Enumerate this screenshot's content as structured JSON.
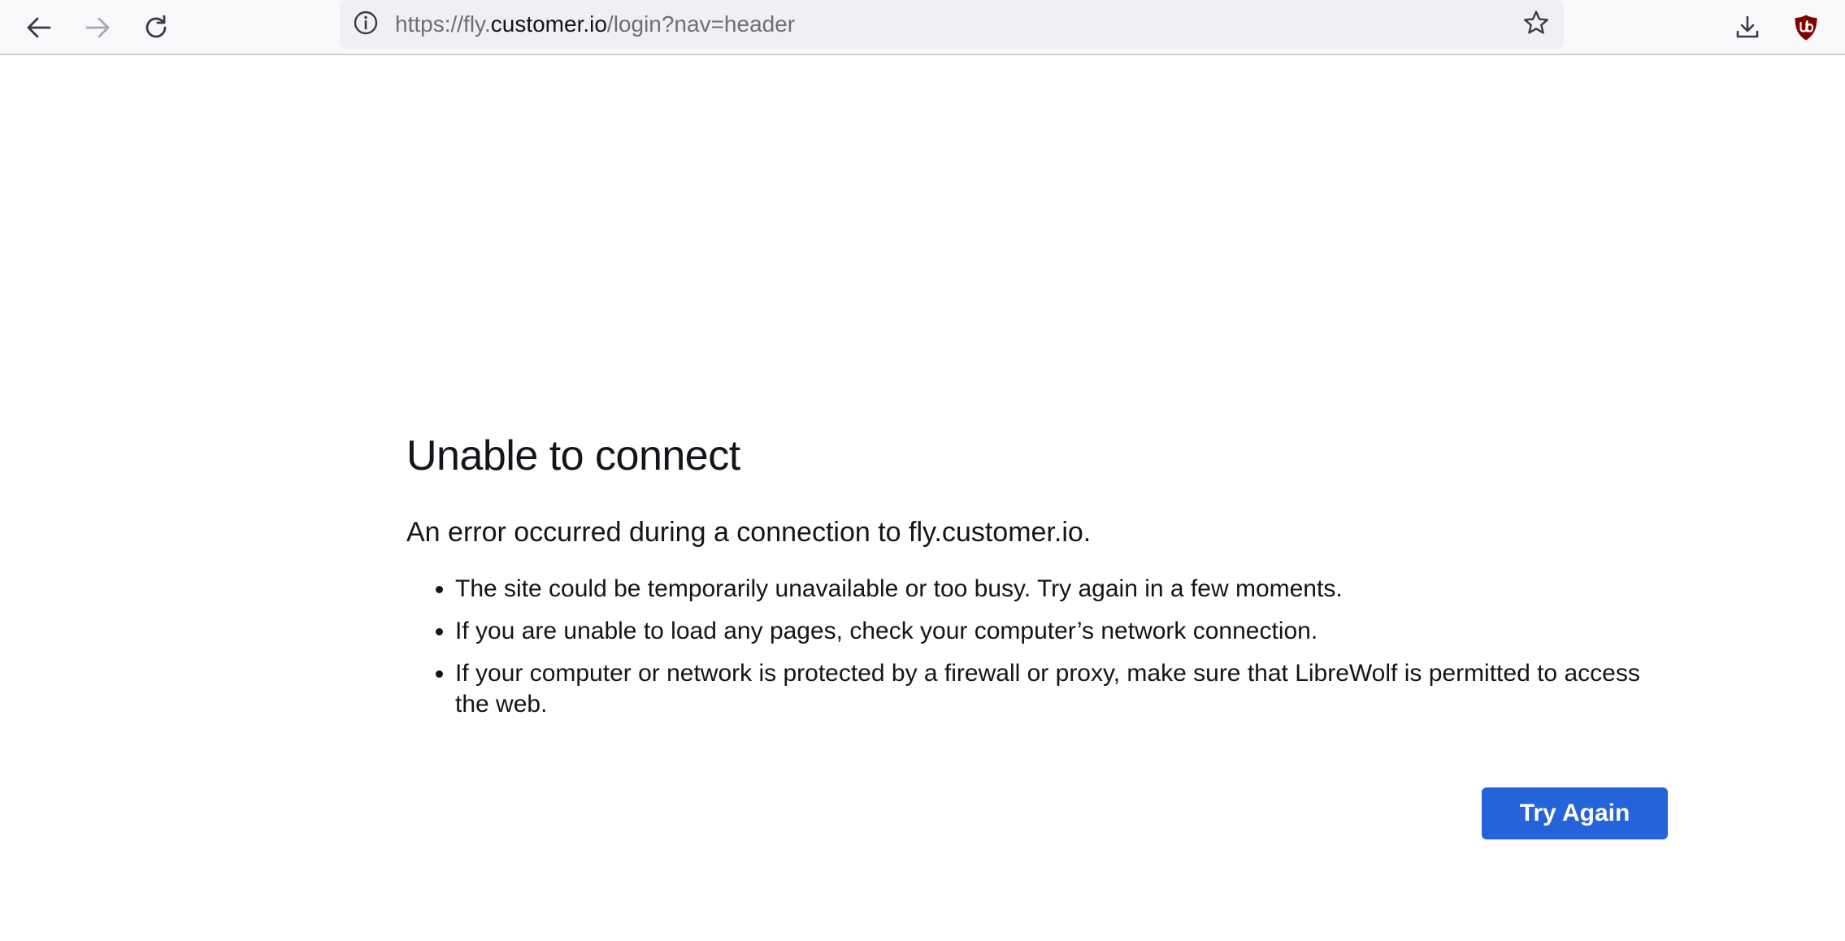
{
  "browser": {
    "url": {
      "prefix": "https://fly.",
      "host": "customer.io",
      "suffix": "/login?nav=header"
    },
    "icons": {
      "back": "arrow-left-icon",
      "forward": "arrow-right-icon",
      "reload": "reload-icon",
      "site_info": "info-circle-icon",
      "bookmark": "star-icon",
      "downloads": "download-icon",
      "extension": "ublock-origin-icon"
    },
    "colors": {
      "toolbar_bg": "#f9f9fb",
      "urlbar_bg": "#f0f0f4",
      "ublock_red": "#800000"
    }
  },
  "error_page": {
    "title": "Unable to connect",
    "description": "An error occurred during a connection to fly.customer.io.",
    "suggestions": [
      "The site could be temporarily unavailable or too busy. Try again in a few moments.",
      "If you are unable to load any pages, check your computer’s network connection.",
      "If your computer or network is protected by a firewall or proxy, make sure that LibreWolf is permitted to access the web."
    ],
    "try_again_label": "Try Again",
    "colors": {
      "button_bg": "#2563db",
      "button_text": "#ffffff"
    }
  }
}
